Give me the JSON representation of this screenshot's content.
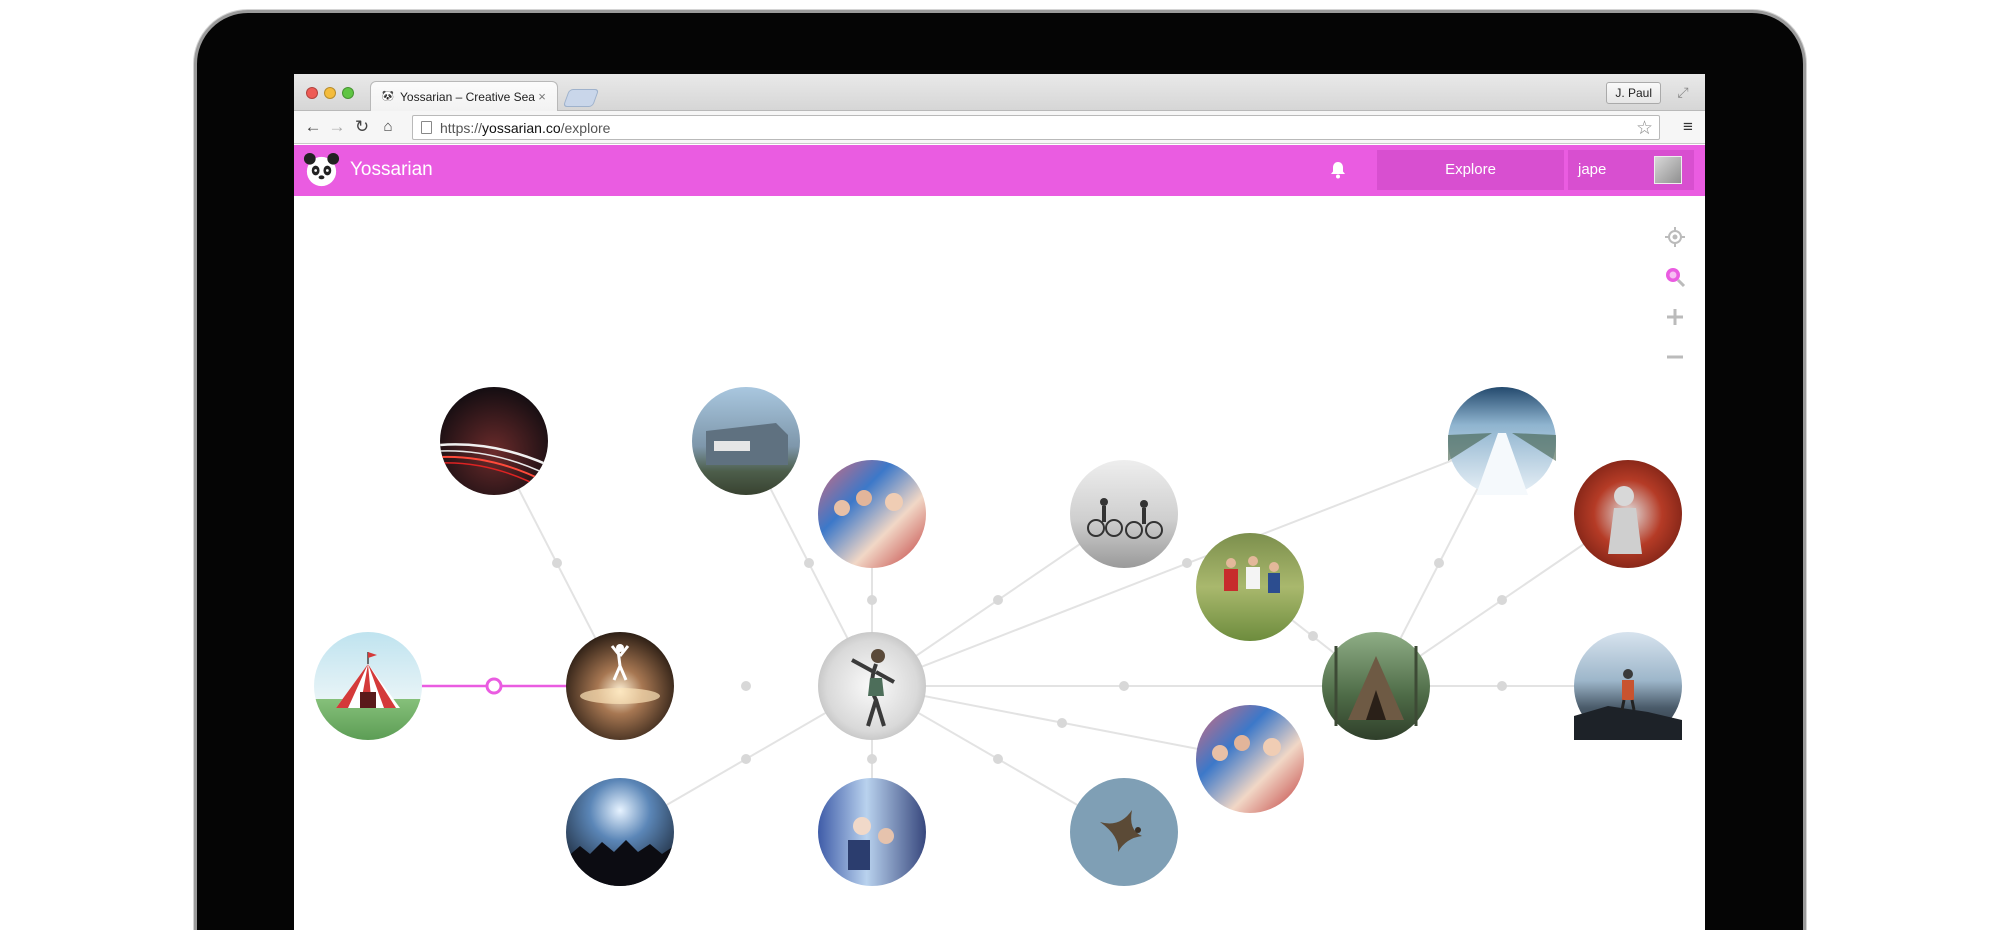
{
  "browser": {
    "tab_title": "Yossarian – Creative Search",
    "tab_favicon": "panda-icon",
    "close_glyph": "×",
    "profile_name": "J. Paul",
    "url_scheme": "https://",
    "url_host": "yossarian.co",
    "url_path": "/explore"
  },
  "app": {
    "brand": "Yossarian",
    "accent_color": "#ea5ce1",
    "nav": {
      "explore_label": "Explore",
      "user_label": "jape"
    }
  },
  "explore": {
    "toolbar_icons": [
      "locate-icon",
      "zoom-search-icon",
      "zoom-in-icon",
      "zoom-out-icon"
    ],
    "nodes": [
      {
        "id": "circus-tent",
        "selected": true
      },
      {
        "id": "light-trails"
      },
      {
        "id": "stage-performer"
      },
      {
        "id": "concert-lights"
      },
      {
        "id": "building"
      },
      {
        "id": "fans-group"
      },
      {
        "id": "dancer-center"
      },
      {
        "id": "crowd-glass"
      },
      {
        "id": "cyclists"
      },
      {
        "id": "bird"
      },
      {
        "id": "football-players"
      },
      {
        "id": "fans-group-2"
      },
      {
        "id": "forest-teepee"
      },
      {
        "id": "snowy-road"
      },
      {
        "id": "theatre-actor"
      },
      {
        "id": "hiker-cliff"
      }
    ]
  }
}
